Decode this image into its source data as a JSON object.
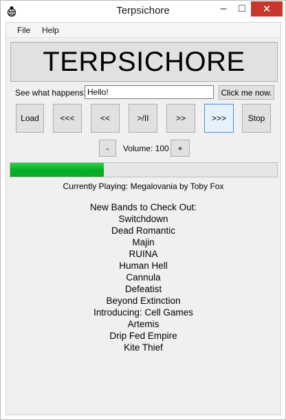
{
  "window": {
    "title": "Terpsichore",
    "minimize_glyph": "–",
    "maximize_glyph": "□",
    "close_glyph": "✕"
  },
  "menu": {
    "file": "File",
    "help": "Help"
  },
  "banner": "TERPSICHORE",
  "prompt": {
    "label": "See what happens:",
    "value": "Hello!",
    "button": "Click me now."
  },
  "controls": {
    "load": "Load",
    "skip_back": "<<<",
    "rewind": "<<",
    "play_pause": ">/II",
    "fast_forward": ">>",
    "skip_forward": ">>>",
    "stop": "Stop"
  },
  "volume": {
    "minus": "-",
    "label": "Volume: 100",
    "plus": "+"
  },
  "progress": {
    "fraction": 0.35,
    "color": "#06b025"
  },
  "now_playing": "Currently Playing: Megalovania by Toby Fox",
  "bands": {
    "heading": "New Bands to Check Out:",
    "items": [
      "Switchdown",
      "Dead Romantic",
      "Majin",
      "RUINA",
      "Human Hell",
      "Cannula",
      "Defeatist",
      "Beyond Extinction",
      "Introducing: Cell Games",
      "Artemis",
      "Drip Fed Empire",
      "Kite Thief"
    ]
  },
  "icons": {
    "app": "ladybug-icon"
  }
}
